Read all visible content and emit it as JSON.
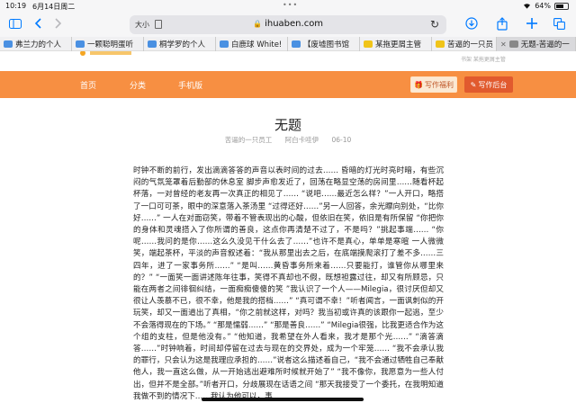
{
  "status": {
    "time": "10:19",
    "date": "6月14日周二",
    "dots": "•••",
    "battery_pct": "64%",
    "battery_level": 0.64
  },
  "toolbar": {
    "text_size": "大小",
    "url": "ihuaben.com",
    "icons": [
      "sidebar-icon",
      "back-icon",
      "forward-icon",
      "text-size-icon",
      "lock-icon",
      "reload-icon",
      "download-icon",
      "share-icon",
      "new-tab-icon",
      "tab-overview-icon"
    ]
  },
  "tabs": [
    {
      "label": "弗兰力的个人",
      "color": "#4a90e2"
    },
    {
      "label": "一颗聪明蛋听",
      "color": "#4a90e2"
    },
    {
      "label": "桐学罗的个人",
      "color": "#4a90e2"
    },
    {
      "label": "白鹿球 White!",
      "color": "#4a90e2"
    },
    {
      "label": "【废墟图书馆",
      "color": "#4a90e2"
    },
    {
      "label": "某拖更屑主管",
      "color": "#f0c419"
    },
    {
      "label": "苦逼的一只员",
      "color": "#f0c419"
    },
    {
      "label": "无题-苦逼的一",
      "color": "#888888"
    }
  ],
  "site": {
    "strip_right": "书架    某拖更屑主管",
    "nav": [
      "首页",
      "分类",
      "手机版"
    ],
    "write_welfare": "写作福利",
    "write_backend": "写作后台"
  },
  "article": {
    "title": "无题",
    "author": "苦逼的一只员工",
    "co_author": "阿白卡哇伊",
    "date": "06-10",
    "body": "时钟不断的前行，发出滴滴答答的声音以表时间的过去…… 昏暗的灯光时亮时暗，有些沉闷的气氛笼罩着后勤部的休息室 脚步声愈发近了，回荡在略显空荡的房间里……随看杯起杯落，一对曾经的老友再一次真正的相见了…… “说吧……最近怎么样？”一人开口，略搭了一口可可茶，眼中的深意落入茶汤里 “过得还好……”另一人回答，余光瞟向别处，“比你好……” 一人在对面窃笑，带着不管表现出的心酸，但依旧在笑，依旧是有所保留 “你把你的身体和灵魂搭入了你所谓的善良，这点你再清楚不过了，不是吗？”挑起事端…… “你呢……我问的是你……这么久没见干什么去了……”也许不是真心，单单是寒暄 一人微微笑，端起茶杯，平淡的声音叙述着：“我从那里出去之后，在底端摸爬滚打了差不多……三四年，进了一家事务所……” “是叫……黄昏事务所来着……只要能打，谁管你从哪里来的？” “一面笑一面讲述陈年往事，笑得不真却也不假，既想袒露过往，却又有所顾忌，只能在两者之间徘徊纠结，一面痴痴傻傻的笑 ”我认识了一个人——Milegia，很讨厌但却又很让人羡慕不已，很不幸，他是我的搭档……” “真可谓不幸！”听者闻言，一面讽刺似的开玩笑，却又一面道出了真相，“你之前就这样，对吗？我当初或许真的该跟你一起逃，至少不会落得现在的下场。” “那是懦弱……” “那是善良……” “Milegia很强，比我更适合作为这个组的支柱，但是他没有。” “他知道，我希望在外人看来，我才是那个光……” “滴答滴答……”时钟响着，时间却停留在过去与现在的交界处，成为一个牢笼…… “我不会承认我的罪行，只会认为这是我理应承担的……”说者这么描述着自己，“我不会通过牺牲自己奉献他人，我一直这么做，从一开始逃出避难所时候就开始了” “我不像你，我愿意为一些人付出，但并不是全部。”听者开口，分歧展现在话语之间 “那天我接受了一个委托，在我明知道我做不到的情况下……我认为他可以，事"
  }
}
